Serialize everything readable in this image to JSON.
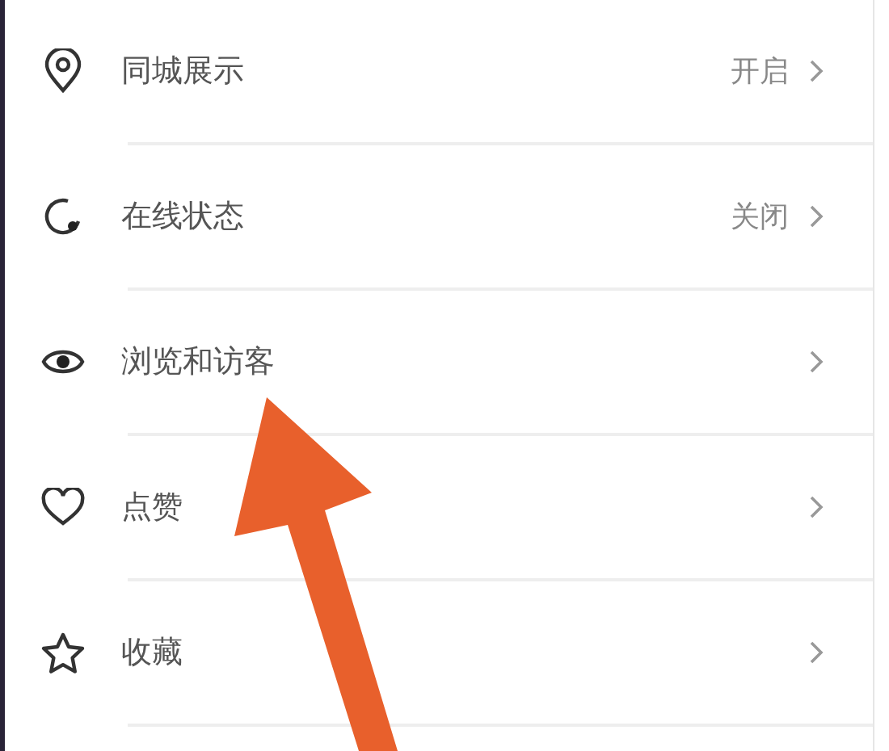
{
  "settings": [
    {
      "label": "同城展示",
      "value": "开启"
    },
    {
      "label": "在线状态",
      "value": "关闭"
    },
    {
      "label": "浏览和访客"
    },
    {
      "label": "点赞"
    },
    {
      "label": "收藏"
    }
  ],
  "annotation": {
    "kind": "arrow"
  }
}
